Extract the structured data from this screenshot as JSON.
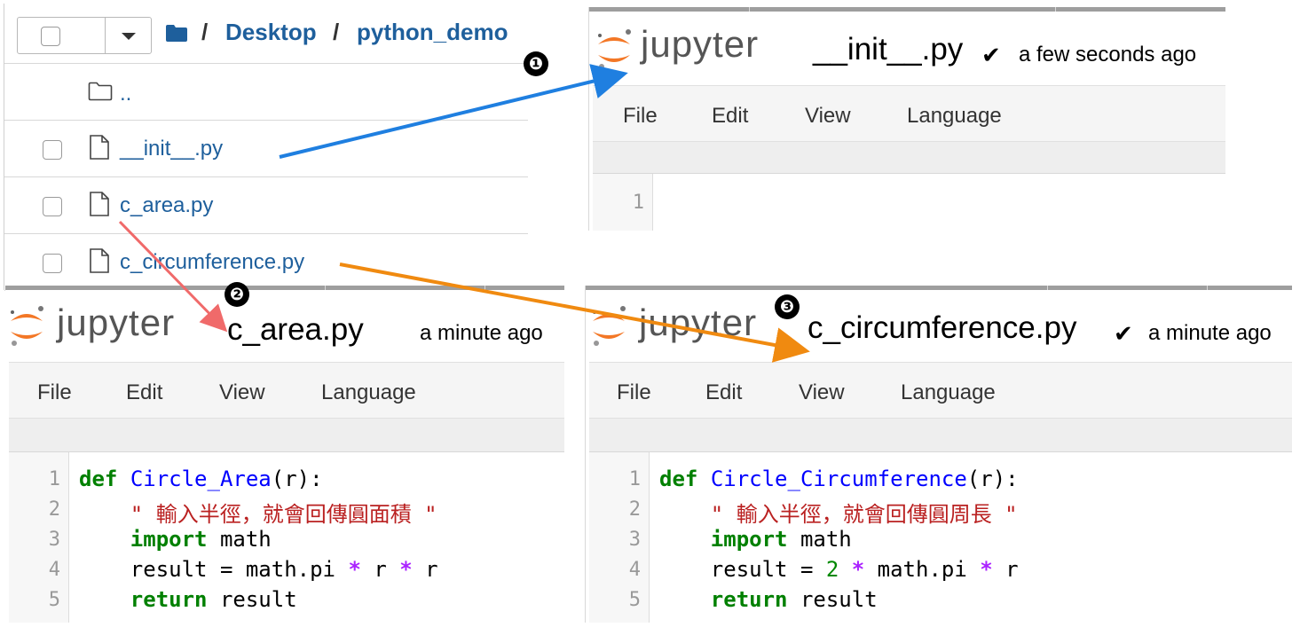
{
  "file_browser": {
    "breadcrumb": {
      "separator": "/",
      "items": [
        "Desktop",
        "python_demo"
      ]
    },
    "parent_link": "..",
    "files": [
      "__init__.py",
      "c_area.py",
      "c_circumference.py"
    ]
  },
  "logo_text": "jupyter",
  "menus": [
    "File",
    "Edit",
    "View",
    "Language"
  ],
  "panes": {
    "init": {
      "title": "__init__.py",
      "saved": "a few seconds ago",
      "line_numbers": [
        "1"
      ]
    },
    "area": {
      "title": "c_area.py",
      "saved": "a minute ago",
      "line_numbers": [
        "1",
        "2",
        "3",
        "4",
        "5"
      ],
      "code": {
        "l1": {
          "kw": "def",
          "fn": "Circle_Area",
          "rest": "(r):"
        },
        "l2": {
          "str": "\" 輸入半徑，就會回傳圓面積 \""
        },
        "l3": {
          "kw": "import",
          "rest": "math"
        },
        "l4": {
          "a": "result = math.pi",
          "op1": "*",
          "b": "r",
          "op2": "*",
          "c": "r"
        },
        "l5": {
          "kw": "return",
          "rest": "result"
        }
      }
    },
    "circ": {
      "title": "c_circumference.py",
      "saved": "a minute ago",
      "line_numbers": [
        "1",
        "2",
        "3",
        "4",
        "5"
      ],
      "code": {
        "l1": {
          "kw": "def",
          "fn": "Circle_Circumference",
          "rest": "(r):"
        },
        "l2": {
          "str": "\" 輸入半徑，就會回傳圓周長 \""
        },
        "l3": {
          "kw": "import",
          "rest": "math"
        },
        "l4": {
          "a": "result =",
          "num": "2",
          "op1": "*",
          "b": "math.pi",
          "op2": "*",
          "c": "r"
        },
        "l5": {
          "kw": "return",
          "rest": "result"
        }
      }
    }
  },
  "badges": [
    "❶",
    "❷",
    "❸"
  ],
  "colors": {
    "link": "#1e5f9c",
    "arrow_blue": "#1f7fe0",
    "arrow_red": "#f06a6a",
    "arrow_orange": "#f08a10",
    "logo_orange": "#f37726"
  }
}
